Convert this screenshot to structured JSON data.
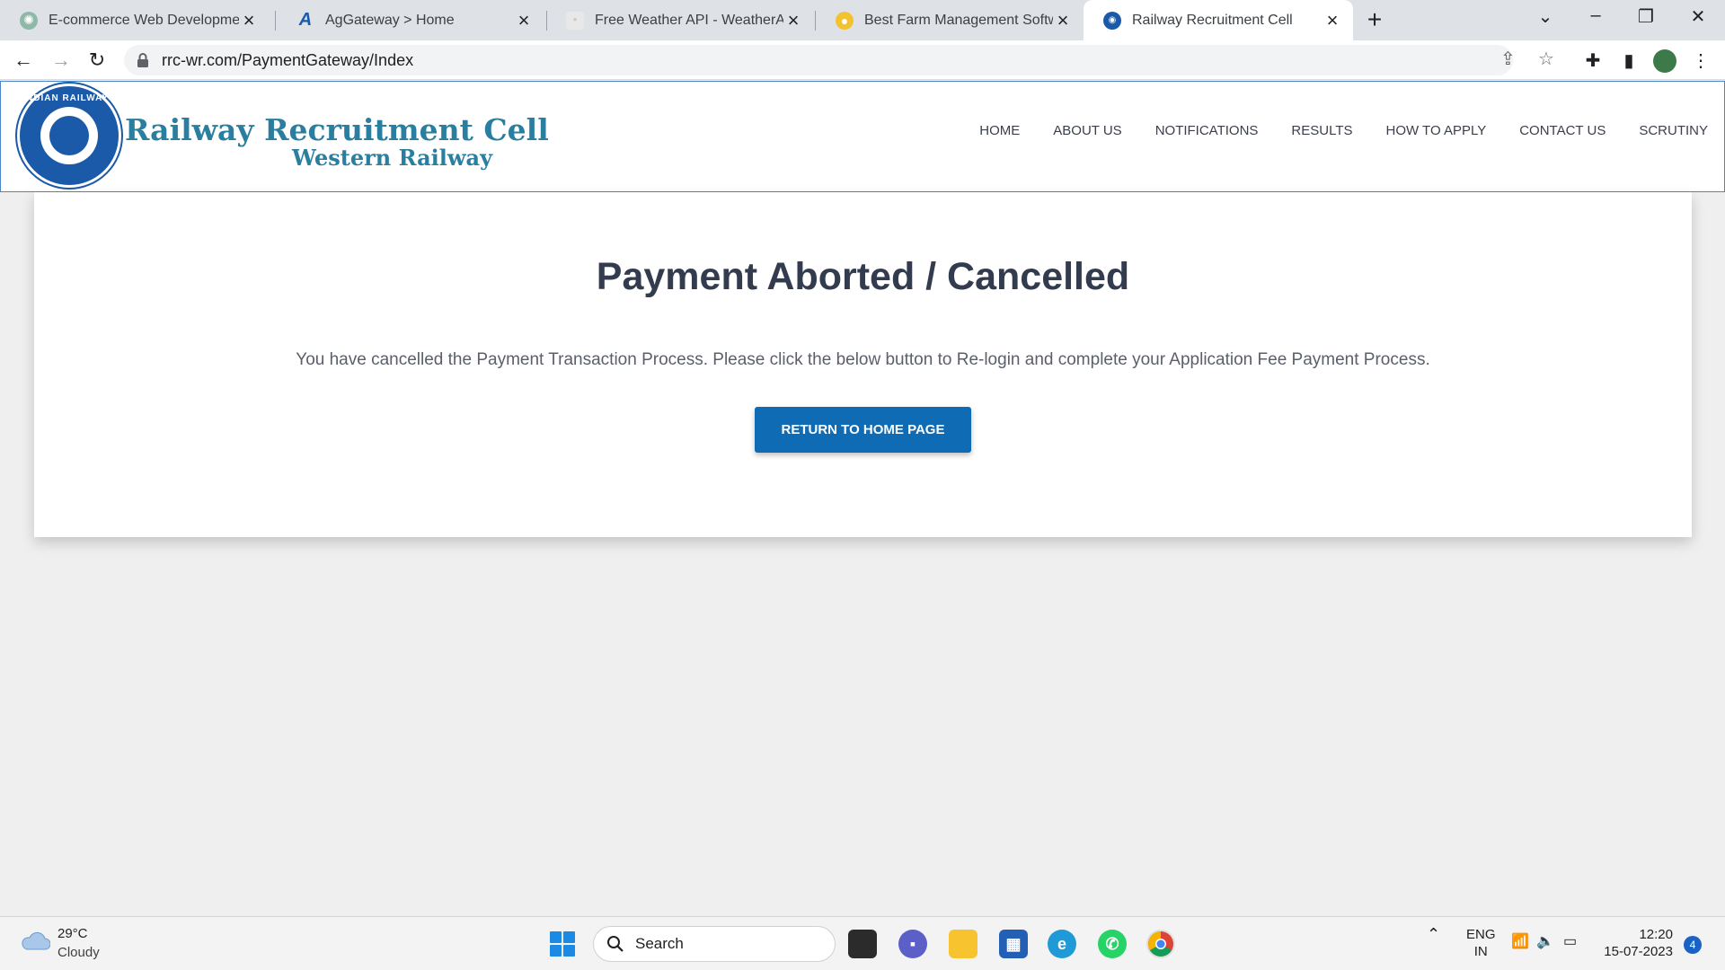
{
  "browser": {
    "tabs": [
      {
        "title": "E-commerce Web Development",
        "icon": "chatgpt-icon",
        "active": false
      },
      {
        "title": "AgGateway > Home",
        "icon": "aggateway-icon",
        "active": false
      },
      {
        "title": "Free Weather API - WeatherAPI.c",
        "icon": "weatherapi-icon",
        "active": false
      },
      {
        "title": "Best Farm Management Software",
        "icon": "farm-icon",
        "active": false
      },
      {
        "title": "Railway Recruitment Cell",
        "icon": "railway-icon",
        "active": true
      }
    ],
    "url": "rrc-wr.com/PaymentGateway/Index"
  },
  "site": {
    "logo_text": "INDIAN RAILWAYS",
    "title": "Railway Recruitment Cell",
    "subtitle": "Western Railway",
    "nav": [
      "HOME",
      "ABOUT US",
      "NOTIFICATIONS",
      "RESULTS",
      "HOW TO APPLY",
      "CONTACT US",
      "SCRUTINY"
    ]
  },
  "content": {
    "heading": "Payment Aborted / Cancelled",
    "message": "You have cancelled the Payment Transaction Process. Please click the below button to Re-login and complete your Application Fee Payment Process.",
    "button_label": "RETURN TO HOME PAGE",
    "button_color": "#0e6bb4"
  },
  "taskbar": {
    "weather_temp": "29°C",
    "weather_condition": "Cloudy",
    "search_label": "Search",
    "language": "ENG",
    "region": "IN",
    "time": "12:20",
    "date": "15-07-2023",
    "notification_count": "4"
  }
}
